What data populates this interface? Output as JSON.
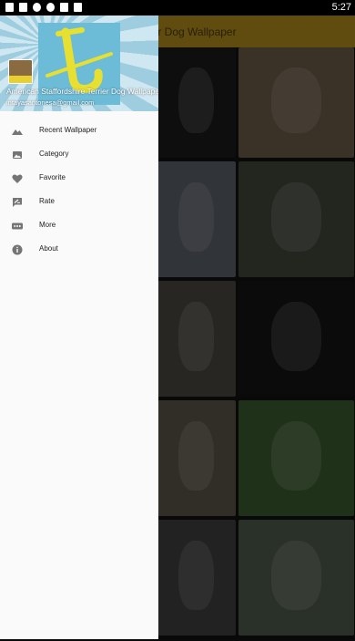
{
  "status_bar": {
    "time": "5:27"
  },
  "toolbar": {
    "title": "rier Dog Wallpaper"
  },
  "drawer": {
    "header": {
      "app_name": "American Staffordshire Terrier Dog Wallpaper",
      "email": "intayasantonesa@gmail.com"
    },
    "items": [
      {
        "label": "Recent Wallpaper",
        "icon": "landscape-icon"
      },
      {
        "label": "Category",
        "icon": "photo-library-icon"
      },
      {
        "label": "Favorite",
        "icon": "heart-icon"
      },
      {
        "label": "Rate",
        "icon": "rate-review-icon"
      },
      {
        "label": "More",
        "icon": "more-horiz-icon"
      },
      {
        "label": "About",
        "icon": "info-icon"
      }
    ]
  },
  "colors": {
    "toolbar": "#b08a1a",
    "drawer_bg": "#fafafa",
    "icon": "#757575"
  }
}
